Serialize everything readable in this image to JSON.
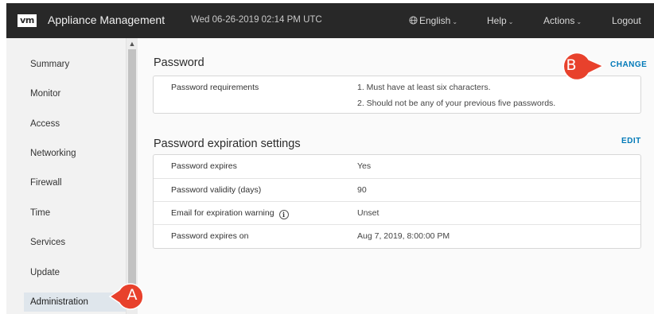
{
  "header": {
    "logo_text": "vm",
    "app_title": "Appliance Management",
    "datetime": "Wed 06-26-2019 02:14 PM UTC",
    "language_label": "English",
    "help_label": "Help",
    "actions_label": "Actions",
    "logout_label": "Logout"
  },
  "sidebar": {
    "items": [
      {
        "label": "Summary"
      },
      {
        "label": "Monitor"
      },
      {
        "label": "Access"
      },
      {
        "label": "Networking"
      },
      {
        "label": "Firewall"
      },
      {
        "label": "Time"
      },
      {
        "label": "Services"
      },
      {
        "label": "Update"
      },
      {
        "label": "Administration"
      }
    ]
  },
  "password": {
    "title": "Password",
    "action": "CHANGE",
    "requirements_label": "Password requirements",
    "requirements": [
      "1. Must have at least six characters.",
      "2. Should not be any of your previous five passwords."
    ]
  },
  "expiration": {
    "title": "Password expiration settings",
    "action": "EDIT",
    "rows": [
      {
        "label": "Password expires",
        "value": "Yes"
      },
      {
        "label": "Password validity (days)",
        "value": "90"
      },
      {
        "label": "Email for expiration warning",
        "value": "Unset"
      },
      {
        "label": "Password expires on",
        "value": "Aug 7, 2019, 8:00:00 PM"
      }
    ]
  },
  "callouts": {
    "a": "A",
    "b": "B",
    "color": "#e8412c"
  },
  "colors": {
    "header_bg": "#282828",
    "link": "#0079b8",
    "active_nav": "#dfe6ec"
  }
}
